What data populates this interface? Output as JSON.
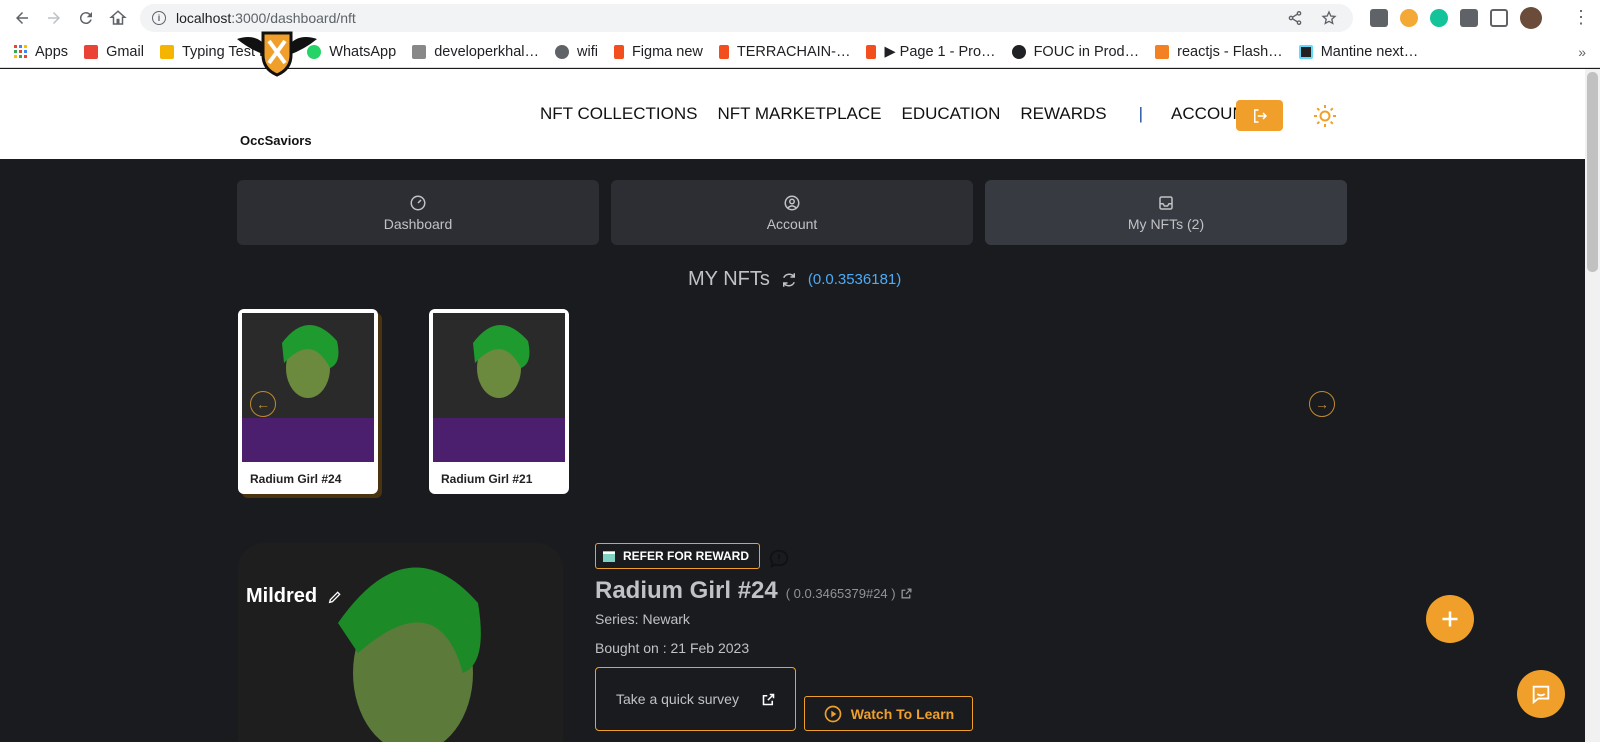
{
  "browser": {
    "url_host": "localhost",
    "url_path": ":3000/dashboard/nft",
    "bookmarks": [
      {
        "label": "Apps",
        "color": "#4285f4"
      },
      {
        "label": "Gmail",
        "color": "#ea4335"
      },
      {
        "label": "Typing Test En…",
        "color": "#f4b400"
      },
      {
        "label": "WhatsApp",
        "color": "#25d366"
      },
      {
        "label": "developerkhal…",
        "color": "#888888"
      },
      {
        "label": "wifi",
        "color": "#5f6368"
      },
      {
        "label": "Figma new",
        "color": "#f24e1e"
      },
      {
        "label": "TERRACHAIN-…",
        "color": "#f24e1e"
      },
      {
        "label": "▶ Page 1 - Pro…",
        "color": "#f24e1e"
      },
      {
        "label": "FOUC in Prod…",
        "color": "#202124"
      },
      {
        "label": "reactjs - Flash…",
        "color": "#f48024"
      },
      {
        "label": "Mantine next…",
        "color": "#61dafb"
      }
    ],
    "bookmarks_more": "»"
  },
  "header": {
    "logo_text": "OccSaviors",
    "nav": [
      "NFT COLLECTIONS",
      "NFT MARKETPLACE",
      "EDUCATION",
      "REWARDS",
      "|",
      "ACCOUNT"
    ]
  },
  "tabs": [
    {
      "label": "Dashboard",
      "icon": "gauge-icon"
    },
    {
      "label": "Account",
      "icon": "user-circle-icon"
    },
    {
      "label": "My NFTs (2)",
      "icon": "inbox-icon"
    }
  ],
  "section": {
    "title": "MY NFTs",
    "account_id": "(0.0.3536181)"
  },
  "nfts": [
    {
      "title": "Radium Girl #24"
    },
    {
      "title": "Radium Girl #21"
    }
  ],
  "detail": {
    "nickname": "Mildred",
    "refer_label": "REFER FOR REWARD",
    "name": "Radium Girl #24",
    "token_id": "( 0.0.3465379#24 )",
    "series": "Series: Newark",
    "bought": "Bought on : 21 Feb 2023",
    "survey_label": "Take a quick survey",
    "watch_label": "Watch To Learn"
  },
  "colors": {
    "accent": "#f0a02a",
    "bg": "#1a1b1e",
    "card_bg": "#2c2e33",
    "link": "#4dabf7"
  }
}
